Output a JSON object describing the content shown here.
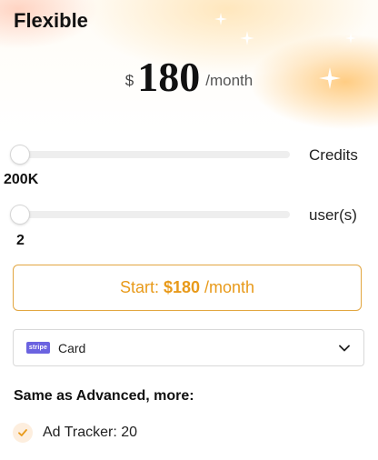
{
  "plan": {
    "title": "Flexible",
    "currency": "$",
    "amount": "180",
    "period": "/month"
  },
  "credits_slider": {
    "label": "Credits",
    "value": "200K",
    "level": 0
  },
  "users_slider": {
    "label": "user(s)",
    "value": "2",
    "level": 0
  },
  "start_button": {
    "prefix": "Start:",
    "price": "$180",
    "suffix": "/month"
  },
  "payment": {
    "badge": "stripe",
    "method": "Card"
  },
  "features": {
    "heading": "Same as Advanced, more:",
    "items": [
      {
        "label": "Ad Tracker: 20"
      }
    ]
  },
  "colors": {
    "accent": "#e89a1a",
    "button_border": "#e2a640",
    "stripe": "#6b63e0",
    "check_bg": "#fdeede"
  },
  "icons": [
    "sparkle-icon",
    "stripe-logo",
    "chevron-down-icon",
    "check-icon"
  ]
}
